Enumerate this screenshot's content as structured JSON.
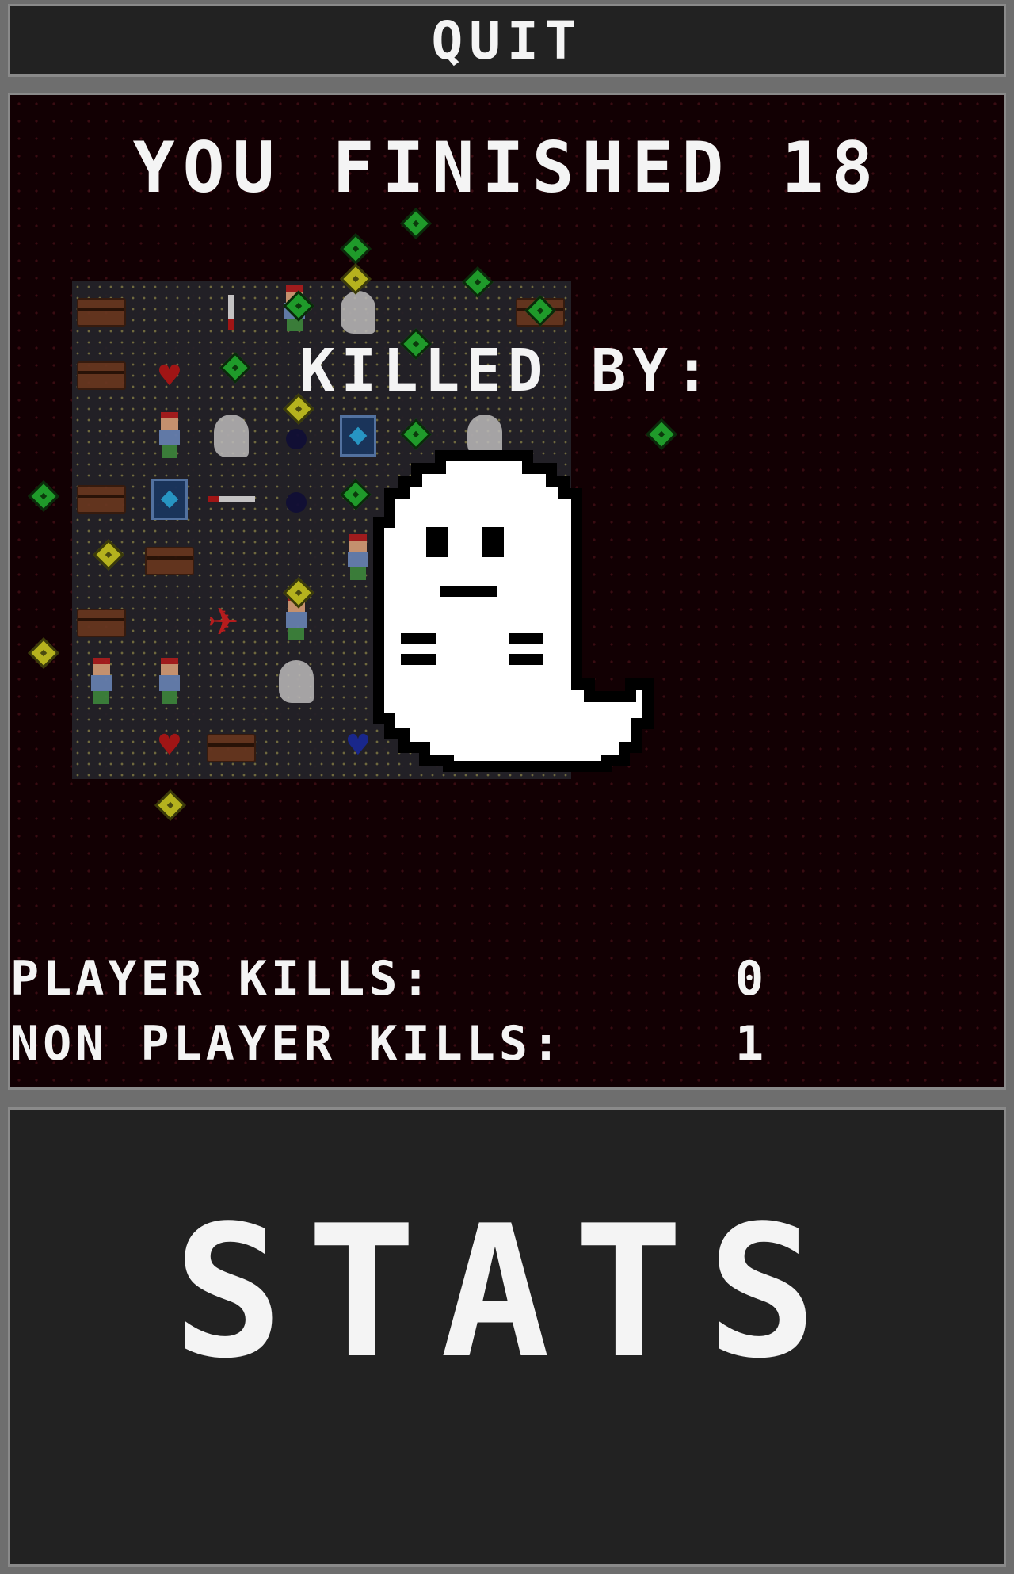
{
  "header": {
    "quit_label": "QUIT"
  },
  "result": {
    "finished_text": "YOU FINISHED 18",
    "killed_by_label": "KILLED BY:"
  },
  "stats": {
    "player_kills_label": "PLAYER KILLS:",
    "player_kills_value": "0",
    "non_player_kills_label": "NON PLAYER KILLS:",
    "non_player_kills_value": "1"
  },
  "footer": {
    "stats_heading": "STATS"
  },
  "colors": {
    "panel_bg": "#222222",
    "game_bg": "#120003",
    "border": "#8a8a8a",
    "text": "#f4f4f4"
  },
  "icons": [
    "chest-icon",
    "heart-icon",
    "ghost-icon",
    "person-icon",
    "book-icon",
    "bomb-icon",
    "knife-icon",
    "plane-icon",
    "green-coin-icon",
    "yellow-coin-icon"
  ]
}
